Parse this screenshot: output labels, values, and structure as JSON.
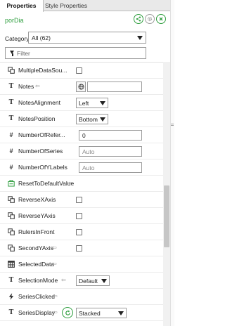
{
  "tabs": [
    {
      "label": "Properties",
      "active": true
    },
    {
      "label": "Style Properties",
      "active": false
    }
  ],
  "header": {
    "object_name": "porDia",
    "buttons": [
      "share-icon",
      "gear-icon",
      "close-icon"
    ]
  },
  "category": {
    "label": "Category",
    "value": "All (62)"
  },
  "filter": {
    "placeholder": "Filter"
  },
  "properties": [
    {
      "name": "MultipleDataSou...",
      "icon": "binding-icon",
      "editor": "checkbox",
      "checked": false
    },
    {
      "name": "Notes",
      "icon": "text-icon",
      "has_arrow": true,
      "editor": "notes",
      "value": ""
    },
    {
      "name": "NotesAlignment",
      "icon": "text-icon",
      "editor": "select",
      "value": "Left"
    },
    {
      "name": "NotesPosition",
      "icon": "text-icon",
      "editor": "select",
      "value": "Bottom"
    },
    {
      "name": "NumberOfRefer...",
      "icon": "hash-icon",
      "editor": "text",
      "value": "0"
    },
    {
      "name": "NumberOfSeries",
      "icon": "hash-icon",
      "editor": "text",
      "placeholder": "Auto"
    },
    {
      "name": "NumberOfYLabels",
      "icon": "hash-icon",
      "editor": "text",
      "placeholder": "Auto"
    },
    {
      "name": "ResetToDefaultValue",
      "icon": "reset-icon",
      "has_arrow": true,
      "editor": "none"
    },
    {
      "name": "ReverseXAxis",
      "icon": "binding-icon",
      "editor": "checkbox",
      "checked": false
    },
    {
      "name": "ReverseYAxis",
      "icon": "binding-icon",
      "editor": "checkbox",
      "checked": false
    },
    {
      "name": "RulersInFront",
      "icon": "binding-icon",
      "editor": "checkbox",
      "checked": false
    },
    {
      "name": "SecondYAxis",
      "icon": "binding-icon",
      "has_arrow": true,
      "editor": "checkbox",
      "checked": false
    },
    {
      "name": "SelectedData",
      "icon": "table-icon",
      "has_arrow": true,
      "editor": "none"
    },
    {
      "name": "SelectionMode",
      "icon": "text-icon",
      "has_arrow": true,
      "editor": "select",
      "value": "Default"
    },
    {
      "name": "SeriesClicked",
      "icon": "lightning-icon",
      "has_arrow": true,
      "editor": "none"
    },
    {
      "name": "SeriesDisplay",
      "icon": "text-icon",
      "has_arrow": true,
      "editor": "select-with-button",
      "value": "Stacked"
    }
  ],
  "colors": {
    "accent": "#2e9e3e",
    "border": "#9a9a9a"
  }
}
